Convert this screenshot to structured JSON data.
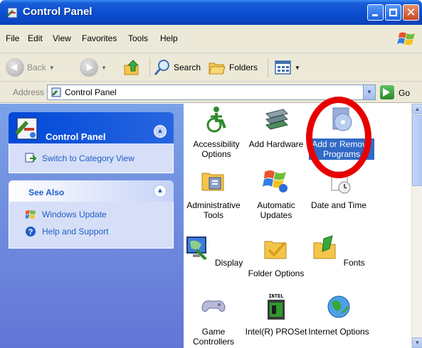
{
  "window": {
    "title": "Control Panel",
    "icon": "control-panel-icon",
    "title_bar_color": "#0b4fd0"
  },
  "menu": {
    "items": [
      "File",
      "Edit",
      "View",
      "Favorites",
      "Tools",
      "Help"
    ]
  },
  "toolbar": {
    "back_label": "Back",
    "search_label": "Search",
    "folders_label": "Folders"
  },
  "address": {
    "label": "Address",
    "value": "Control Panel",
    "go_label": "Go"
  },
  "taskpane": {
    "control_panel": {
      "title": "Control Panel",
      "link": "Switch to Category View"
    },
    "see_also": {
      "title": "See Also",
      "links": [
        "Windows Update",
        "Help and Support"
      ]
    }
  },
  "items": [
    {
      "label": "Accessibility Options",
      "icon": "accessibility-icon"
    },
    {
      "label": "Add Hardware",
      "icon": "add-hardware-icon"
    },
    {
      "label": "Add or Remove Programs",
      "icon": "add-remove-programs-icon",
      "selected": true
    },
    {
      "label": "Administrative Tools",
      "icon": "administrative-tools-icon"
    },
    {
      "label": "Automatic Updates",
      "icon": "automatic-updates-icon"
    },
    {
      "label": "Date and Time",
      "icon": "date-time-icon"
    },
    {
      "label": "Display",
      "icon": "display-icon"
    },
    {
      "label": "Folder Options",
      "icon": "folder-options-icon"
    },
    {
      "label": "Fonts",
      "icon": "fonts-icon"
    },
    {
      "label": "Game Controllers",
      "icon": "game-controllers-icon"
    },
    {
      "label": "Intel(R) PROSet",
      "icon": "intel-proset-icon"
    },
    {
      "label": "Internet Options",
      "icon": "internet-options-icon"
    }
  ],
  "annotation": {
    "highlight_color": "#e80000"
  }
}
